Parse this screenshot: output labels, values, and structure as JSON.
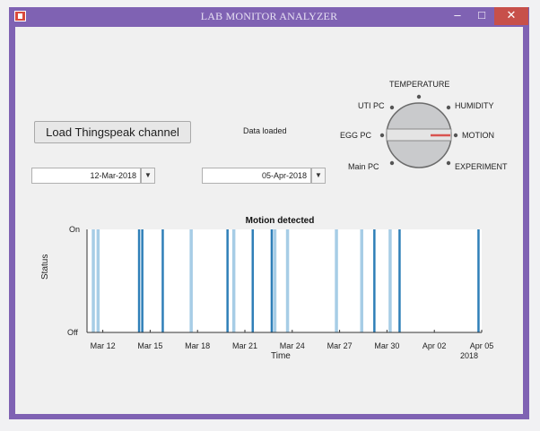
{
  "window": {
    "title": "LAB MONITOR ANALYZER",
    "min_glyph": "–",
    "max_glyph": "□",
    "close_glyph": "✕",
    "icon": "matlab-figure-icon"
  },
  "controls": {
    "load_button": "Load Thingspeak channel",
    "status_text": "Data loaded",
    "start_date": "12-Mar-2018",
    "end_date": "05-Apr-2018",
    "dropdown_glyph": "▼"
  },
  "selector": {
    "labels": {
      "temperature": "TEMPERATURE",
      "uti_pc": "UTI PC",
      "humidity": "HUMIDITY",
      "egg_pc": "EGG PC",
      "motion": "MOTION",
      "main_pc": "Main PC",
      "experiment": "EXPERIMENT"
    },
    "selected": "MOTION",
    "indicator_color": "#d9534f"
  },
  "chart_data": {
    "type": "bar",
    "title": "Motion detected",
    "xlabel": "Time",
    "ylabel": "Status",
    "yticks": [
      "Off",
      "On"
    ],
    "xticks": [
      "Mar 12",
      "Mar 15",
      "Mar 18",
      "Mar 21",
      "Mar 24",
      "Mar 27",
      "Mar 30",
      "Apr 02",
      "Apr 05"
    ],
    "xtick_year": "2018",
    "xlim": [
      "2018-03-11",
      "2018-04-05"
    ],
    "ylim": [
      0,
      1
    ],
    "bar_colors": {
      "strong": "#2f7fb8",
      "light": "#a7cde6"
    },
    "events": [
      {
        "date": "2018-03-11",
        "day": 11.4,
        "strength": "light"
      },
      {
        "date": "2018-03-11",
        "day": 11.7,
        "strength": "light"
      },
      {
        "date": "2018-03-14",
        "day": 14.3,
        "strength": "strong"
      },
      {
        "date": "2018-03-14",
        "day": 14.5,
        "strength": "strong"
      },
      {
        "date": "2018-03-15",
        "day": 15.8,
        "strength": "strong"
      },
      {
        "date": "2018-03-17",
        "day": 17.6,
        "strength": "light"
      },
      {
        "date": "2018-03-19",
        "day": 19.9,
        "strength": "strong"
      },
      {
        "date": "2018-03-20",
        "day": 20.3,
        "strength": "light"
      },
      {
        "date": "2018-03-21",
        "day": 21.5,
        "strength": "strong"
      },
      {
        "date": "2018-03-22",
        "day": 22.7,
        "strength": "strong"
      },
      {
        "date": "2018-03-22",
        "day": 22.9,
        "strength": "light"
      },
      {
        "date": "2018-03-23",
        "day": 23.7,
        "strength": "light"
      },
      {
        "date": "2018-03-26",
        "day": 26.8,
        "strength": "light"
      },
      {
        "date": "2018-03-28",
        "day": 28.4,
        "strength": "light"
      },
      {
        "date": "2018-03-29",
        "day": 29.2,
        "strength": "strong"
      },
      {
        "date": "2018-03-30",
        "day": 30.2,
        "strength": "light"
      },
      {
        "date": "2018-03-30",
        "day": 30.8,
        "strength": "strong"
      },
      {
        "date": "2018-04-04",
        "day": 35.8,
        "strength": "strong"
      }
    ]
  }
}
